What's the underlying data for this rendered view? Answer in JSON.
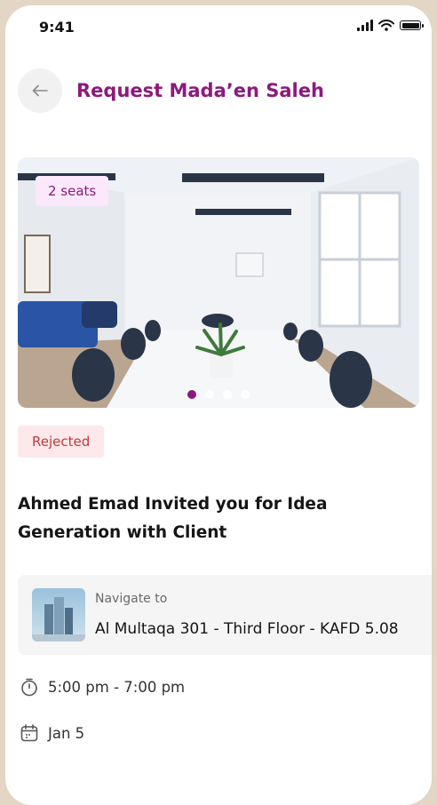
{
  "status_bar": {
    "time": "9:41"
  },
  "header": {
    "title": "Request Mada’en Saleh"
  },
  "room": {
    "seats_badge": "2 seats",
    "carousel_total": 4,
    "carousel_active_index": 0
  },
  "request": {
    "status": "Rejected",
    "invite_line1": "Ahmed Emad Invited you for Idea",
    "invite_line2": "Generation with Client"
  },
  "navigate": {
    "label": "Navigate to",
    "location": "Al Multaqa 301 - Third Floor - KAFD 5.08"
  },
  "details": {
    "time_range": "5:00 pm - 7:00 pm",
    "date": "Jan 5"
  },
  "colors": {
    "brand": "#8c1a7c",
    "rejected_text": "#c0393f",
    "rejected_bg": "#fde8ea",
    "badge_bg": "#fbe8fa"
  },
  "icons": [
    "back-arrow-icon",
    "signal-icon",
    "wifi-icon",
    "battery-icon",
    "timer-icon",
    "calendar-icon"
  ]
}
